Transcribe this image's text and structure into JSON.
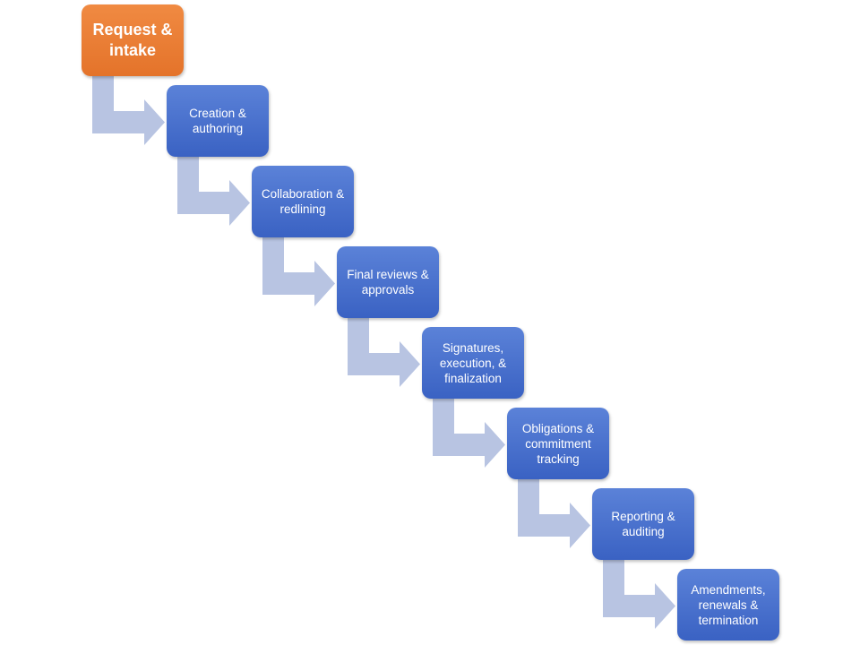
{
  "colors": {
    "first_step": "#ed7d31",
    "step": "#4472c4",
    "arrow": "#b8c4e2"
  },
  "steps": [
    {
      "label": "Request & intake"
    },
    {
      "label": "Creation & authoring"
    },
    {
      "label": "Collaboration & redlining"
    },
    {
      "label": "Final reviews & approvals"
    },
    {
      "label": "Signatures, execution, & finalization"
    },
    {
      "label": "Obligations & commitment tracking"
    },
    {
      "label": "Reporting & auditing"
    },
    {
      "label": "Amendments, renewals & termination"
    }
  ]
}
